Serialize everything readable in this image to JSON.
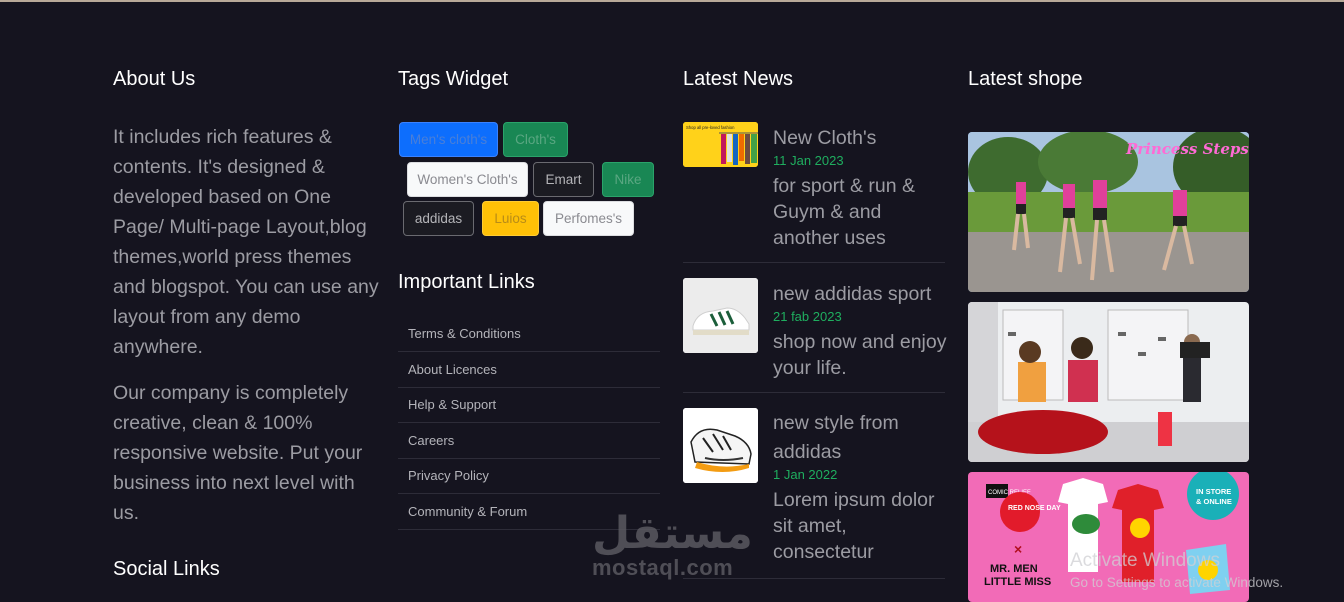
{
  "about": {
    "heading": "About Us",
    "paragraph1": "It includes rich features & contents. It's designed & developed based on One Page/ Multi-page Layout,blog themes,world press themes and blogspot. You can use any layout from any demo anywhere.",
    "paragraph2": "Our company is completely creative, clean & 100% responsive website. Put your business into next level with us.",
    "social_heading": "Social Links"
  },
  "tags_widget": {
    "heading": "Tags Widget",
    "tags": [
      {
        "label": "Men's cloth's",
        "color": "blue"
      },
      {
        "label": "Cloth's",
        "color": "green"
      },
      {
        "label": "Women's Cloth's",
        "color": "white"
      },
      {
        "label": "Emart",
        "color": "dark"
      },
      {
        "label": "Nike",
        "color": "green"
      },
      {
        "label": "addidas",
        "color": "dark"
      },
      {
        "label": "Luios",
        "color": "yellow"
      },
      {
        "label": "Perfomes's",
        "color": "white"
      }
    ]
  },
  "important_links": {
    "heading": "Important Links",
    "items": [
      "Terms & Conditions",
      "About Licences",
      "Help & Support",
      "Careers",
      "Privacy Policy",
      "Community & Forum"
    ]
  },
  "latest_news": {
    "heading": "Latest News",
    "items": [
      {
        "title": "New Cloth's",
        "date": "11 Jan 2023",
        "desc": "for sport & run & Guym & and another uses",
        "thumb_text": "Shop all pre-loved fashion"
      },
      {
        "title": "new addidas sport",
        "date": "21 fab 2023",
        "desc": "shop now and enjoy your life."
      },
      {
        "title": "new style from addidas",
        "date": "1 Jan 2022",
        "desc": "Lorem ipsum dolor sit amet, consectetur"
      }
    ]
  },
  "latest_shop": {
    "heading": "Latest shope",
    "banner1_text": "Princess Steps!",
    "banner3": {
      "badge_top": "IN STORE",
      "badge_bottom": "& ONLINE",
      "comic": "COMIC RELIEF",
      "red_nose": "RED NOSE DAY",
      "cross": "×",
      "mr_men": "MR. MEN",
      "little_miss": "LITTLE MISS"
    }
  },
  "watermark": {
    "arabic": "مستقل",
    "latin": "mostaql.com"
  },
  "windows_notice": {
    "title": "Activate Windows",
    "subtitle": "Go to Settings to activate Windows."
  },
  "colors": {
    "background": "#15141f",
    "date_green": "#1fae5f",
    "heading": "#ffffff",
    "text": "#9c9ca3"
  }
}
